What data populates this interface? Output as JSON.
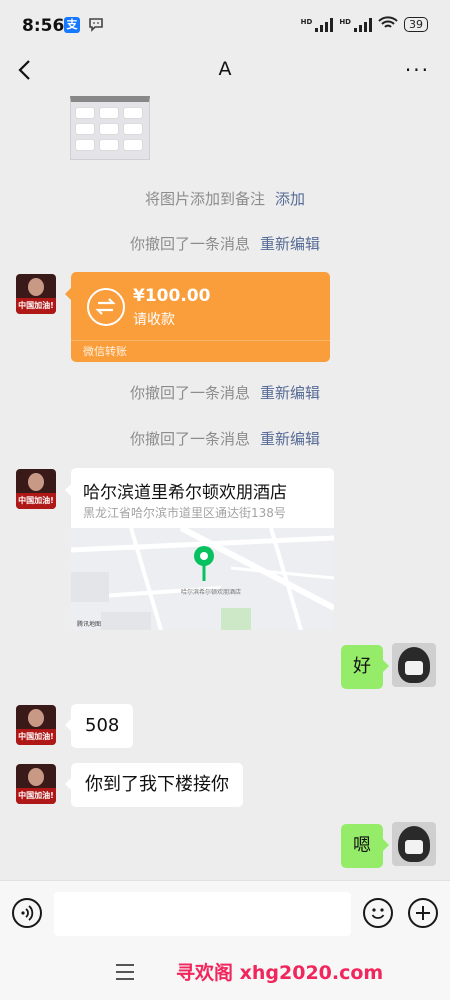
{
  "status_bar": {
    "time": "8:56",
    "alipay_glyph": "支",
    "message_icon": "message-icon",
    "battery": "39",
    "hd1": "HD",
    "hd2": "HD"
  },
  "nav": {
    "title": "A",
    "back_icon": "back-chevron-icon",
    "more_glyph": "···"
  },
  "messages": {
    "add_note": {
      "text": "将图片添加到备注",
      "link": "添加"
    },
    "recall1": {
      "text": "你撤回了一条消息",
      "link": "重新编辑"
    },
    "transfer": {
      "amount": "¥100.00",
      "desc": "请收款",
      "footer": "微信转账"
    },
    "recall2": {
      "text": "你撤回了一条消息",
      "link": "重新编辑"
    },
    "recall3": {
      "text": "你撤回了一条消息",
      "link": "重新编辑"
    },
    "location": {
      "name": "哈尔滨道里希尔顿欢朋酒店",
      "address": "黑龙江省哈尔滨市道里区通达街138号",
      "map_pin_label": "哈尔滨希尔顿欢朋酒店",
      "map_credit": "腾讯地图"
    },
    "reply1": "好",
    "msg_508": "508",
    "msg_pickup": "你到了我下楼接你",
    "reply2": "嗯"
  },
  "left_avatar_caption": "中国加油!",
  "input_bar": {
    "voice_icon": "voice-icon",
    "emoji_icon": "emoji-icon",
    "plus_icon": "plus-icon"
  },
  "bottom_bar": {
    "menu_icon": "menu-icon",
    "watermark": "寻欢阁 xhg2020.com"
  },
  "colors": {
    "background": "#ededed",
    "transfer": "#fa9d3b",
    "bubble_right": "#95ec69",
    "link": "#576b95",
    "watermark": "#f0265c"
  }
}
